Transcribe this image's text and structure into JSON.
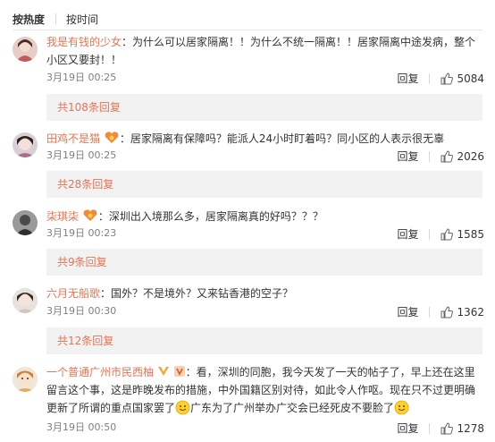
{
  "tabs": {
    "hot": "按热度",
    "time": "按时间"
  },
  "actions": {
    "reply_label": "回复"
  },
  "comments": [
    {
      "user": "我是有钱的少女",
      "text": "：为什么可以居家隔离！！为什么不统一隔离！！居家隔离中途发病，整个小区又要封！！",
      "time": "3月19日 00:25",
      "likes": "5084",
      "replies": "共108条回复"
    },
    {
      "user": "田鸡不是猫",
      "text": "：居家隔离有保障吗？能派人24小时盯着吗？同小区的人表示很无辜",
      "time": "3月19日 00:25",
      "likes": "2026",
      "replies": "共28条回复"
    },
    {
      "user": "柒琪柒",
      "text": "：深圳出入境那么多，居家隔离真的好吗？？？",
      "time": "3月19日 00:23",
      "likes": "1585",
      "replies": "共9条回复"
    },
    {
      "user": "六月无船歌",
      "text": "：国外？不是境外？又来钻香港的空子？",
      "time": "3月19日 00:30",
      "likes": "1362",
      "replies": "共12条回复"
    },
    {
      "user": "一个普通广州市民西柚",
      "text_a": "：看，深圳的同胞，我今天发了一天的帖子了，早上还在这里留言这个事，这是昨晚发布的措施，中外国籍区别对待，如此令人作呕。现在只不过更明确更新了所谓的重点国家罢了",
      "text_b": "广东为了广州举办广交会已经死皮不要脸了",
      "time": "3月19日 00:50",
      "likes": "1278"
    }
  ],
  "colors": {
    "username": "#eb7350",
    "reply_box": "#f2f2f2",
    "meta": "#808080"
  }
}
